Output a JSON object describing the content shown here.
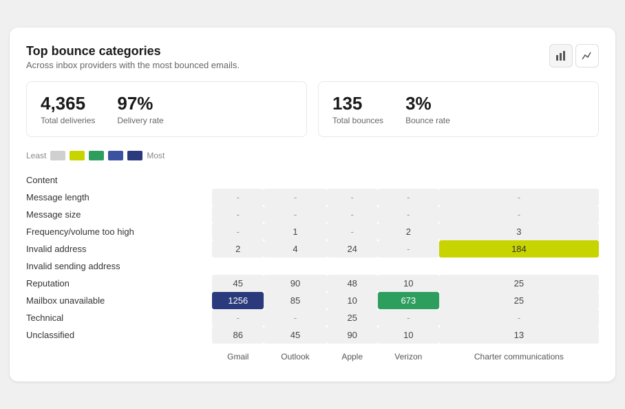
{
  "title": "Top bounce categories",
  "subtitle": "Across inbox providers with the most bounced emails.",
  "buttons": {
    "bar_chart": "bar-chart",
    "line_chart": "line-chart"
  },
  "stats": [
    {
      "id": "deliveries",
      "value": "4,365",
      "label": "Total deliveries"
    },
    {
      "id": "delivery_rate",
      "value": "97%",
      "label": "Delivery rate"
    },
    {
      "id": "bounces",
      "value": "135",
      "label": "Total bounces"
    },
    {
      "id": "bounce_rate",
      "value": "3%",
      "label": "Bounce rate"
    }
  ],
  "legend": {
    "least": "Least",
    "most": "Most",
    "swatches": [
      "#d0d0d0",
      "#c8d400",
      "#2e9e5e",
      "#3a52a0",
      "#2a3a7c"
    ]
  },
  "columns": [
    "Gmail",
    "Outlook",
    "Apple",
    "Verizon",
    "Charter communications"
  ],
  "rows": [
    {
      "label": "Content",
      "values": [
        "",
        "",
        "",
        "",
        ""
      ],
      "highlights": [
        "none",
        "none",
        "none",
        "none",
        "none"
      ]
    },
    {
      "label": "Message length",
      "values": [
        "-",
        "-",
        "-",
        "-",
        "-"
      ],
      "highlights": [
        "bg",
        "bg",
        "bg",
        "bg",
        "bg"
      ]
    },
    {
      "label": "Message size",
      "values": [
        "-",
        "-",
        "-",
        "-",
        "-"
      ],
      "highlights": [
        "bg",
        "bg",
        "bg",
        "bg",
        "bg"
      ]
    },
    {
      "label": "Frequency/volume too high",
      "values": [
        "-",
        "1",
        "-",
        "2",
        "3"
      ],
      "highlights": [
        "bg",
        "bg",
        "bg",
        "bg",
        "bg"
      ]
    },
    {
      "label": "Invalid address",
      "values": [
        "2",
        "4",
        "24",
        "-",
        "184"
      ],
      "highlights": [
        "bg",
        "bg",
        "bg",
        "bg",
        "yellow"
      ]
    },
    {
      "label": "Invalid sending address",
      "values": [
        "",
        "",
        "",
        "",
        ""
      ],
      "highlights": [
        "none",
        "none",
        "none",
        "none",
        "none"
      ]
    },
    {
      "label": "Reputation",
      "values": [
        "45",
        "90",
        "48",
        "10",
        "25"
      ],
      "highlights": [
        "bg",
        "bg",
        "bg",
        "bg",
        "bg"
      ]
    },
    {
      "label": "Mailbox unavailable",
      "values": [
        "1256",
        "85",
        "10",
        "673",
        "25"
      ],
      "highlights": [
        "dark-blue",
        "bg",
        "bg",
        "green",
        "bg"
      ]
    },
    {
      "label": "Technical",
      "values": [
        "-",
        "-",
        "25",
        "-",
        "-"
      ],
      "highlights": [
        "bg",
        "bg",
        "bg",
        "bg",
        "bg"
      ]
    },
    {
      "label": "Unclassified",
      "values": [
        "86",
        "45",
        "90",
        "10",
        "13"
      ],
      "highlights": [
        "bg",
        "bg",
        "bg",
        "bg",
        "bg"
      ]
    }
  ]
}
